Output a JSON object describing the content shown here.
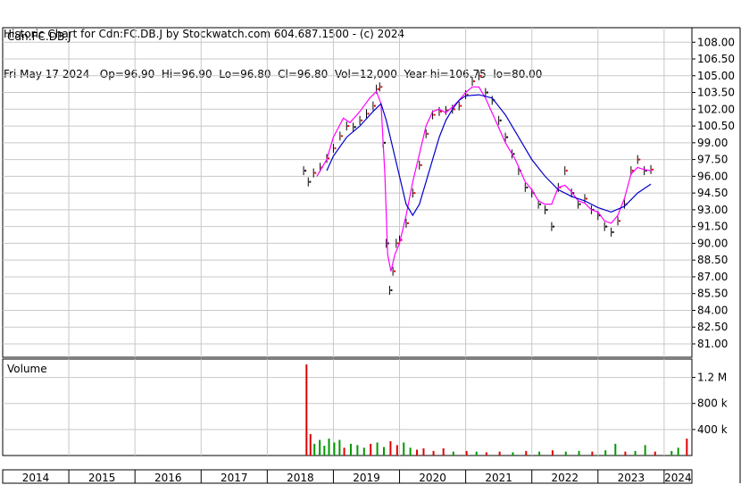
{
  "header": {
    "line1": "Historic Chart for Cdn:FC.DB.J by Stockwatch.com 604.687.1500 - (c) 2024",
    "line2": "Fri May 17 2024   Op=96.90  Hi=96.90  Lo=96.80  Cl=96.80  Vol=12,000  Year hi=106.75  lo=80.00"
  },
  "chart_data": {
    "type": "line",
    "title": "Cdn:FC.DB.J",
    "ylim": [
      79.8,
      109.3
    ],
    "y_ticks": [
      "108.00",
      "106.50",
      "105.00",
      "103.50",
      "102.00",
      "100.50",
      "99.00",
      "97.50",
      "96.00",
      "94.50",
      "93.00",
      "91.50",
      "90.00",
      "88.50",
      "87.00",
      "85.50",
      "84.00",
      "82.50",
      "81.00"
    ],
    "x_years": [
      "2014",
      "2015",
      "2016",
      "2017",
      "2018",
      "2019",
      "2020",
      "2021",
      "2022",
      "2023",
      "2024"
    ],
    "x_range": [
      2014.0,
      2024.42
    ],
    "price": [
      [
        2018.55,
        96.5
      ],
      [
        2018.62,
        95.5
      ],
      [
        2018.7,
        96.3
      ],
      [
        2018.8,
        96.8
      ],
      [
        2018.9,
        97.6
      ],
      [
        2019.0,
        98.5
      ],
      [
        2019.1,
        99.6
      ],
      [
        2019.2,
        100.5
      ],
      [
        2019.3,
        100.4
      ],
      [
        2019.4,
        101.0
      ],
      [
        2019.5,
        101.6
      ],
      [
        2019.6,
        102.3
      ],
      [
        2019.65,
        103.8
      ],
      [
        2019.7,
        104.0
      ],
      [
        2019.75,
        99.0
      ],
      [
        2019.8,
        90.0
      ],
      [
        2019.85,
        85.8
      ],
      [
        2019.9,
        87.5
      ],
      [
        2019.95,
        90.0
      ],
      [
        2020.0,
        90.3
      ],
      [
        2020.1,
        91.8
      ],
      [
        2020.2,
        94.5
      ],
      [
        2020.3,
        97.0
      ],
      [
        2020.4,
        99.8
      ],
      [
        2020.5,
        101.5
      ],
      [
        2020.6,
        101.8
      ],
      [
        2020.7,
        101.9
      ],
      [
        2020.8,
        102.0
      ],
      [
        2020.9,
        102.3
      ],
      [
        2021.0,
        103.3
      ],
      [
        2021.1,
        104.5
      ],
      [
        2021.2,
        105.0
      ],
      [
        2021.3,
        103.5
      ],
      [
        2021.4,
        102.8
      ],
      [
        2021.5,
        101.0
      ],
      [
        2021.6,
        99.5
      ],
      [
        2021.7,
        98.0
      ],
      [
        2021.8,
        96.5
      ],
      [
        2021.9,
        95.0
      ],
      [
        2022.0,
        94.5
      ],
      [
        2022.1,
        93.5
      ],
      [
        2022.2,
        93.0
      ],
      [
        2022.3,
        91.5
      ],
      [
        2022.4,
        95.0
      ],
      [
        2022.5,
        96.5
      ],
      [
        2022.6,
        94.5
      ],
      [
        2022.7,
        93.5
      ],
      [
        2022.8,
        94.0
      ],
      [
        2022.9,
        93.0
      ],
      [
        2023.0,
        92.5
      ],
      [
        2023.1,
        91.5
      ],
      [
        2023.2,
        91.0
      ],
      [
        2023.3,
        92.0
      ],
      [
        2023.4,
        93.5
      ],
      [
        2023.5,
        96.5
      ],
      [
        2023.6,
        97.5
      ],
      [
        2023.7,
        96.5
      ],
      [
        2023.8,
        96.6
      ]
    ],
    "series": [
      {
        "color": "#ff00ff",
        "values": [
          [
            2018.75,
            96.0
          ],
          [
            2018.9,
            97.5
          ],
          [
            2019.0,
            99.5
          ],
          [
            2019.15,
            101.2
          ],
          [
            2019.25,
            100.8
          ],
          [
            2019.4,
            101.8
          ],
          [
            2019.55,
            103.0
          ],
          [
            2019.65,
            103.6
          ],
          [
            2019.72,
            102.5
          ],
          [
            2019.78,
            96.0
          ],
          [
            2019.82,
            89.0
          ],
          [
            2019.87,
            87.5
          ],
          [
            2019.93,
            89.0
          ],
          [
            2020.0,
            90.0
          ],
          [
            2020.1,
            92.5
          ],
          [
            2020.2,
            95.5
          ],
          [
            2020.3,
            98.0
          ],
          [
            2020.4,
            100.5
          ],
          [
            2020.5,
            101.8
          ],
          [
            2020.6,
            102.0
          ],
          [
            2020.7,
            101.7
          ],
          [
            2020.8,
            102.2
          ],
          [
            2020.9,
            102.8
          ],
          [
            2021.0,
            103.5
          ],
          [
            2021.1,
            104.0
          ],
          [
            2021.2,
            104.0
          ],
          [
            2021.3,
            103.0
          ],
          [
            2021.45,
            101.0
          ],
          [
            2021.6,
            99.0
          ],
          [
            2021.75,
            97.5
          ],
          [
            2021.9,
            95.5
          ],
          [
            2022.0,
            94.8
          ],
          [
            2022.1,
            93.8
          ],
          [
            2022.2,
            93.5
          ],
          [
            2022.3,
            93.5
          ],
          [
            2022.4,
            95.0
          ],
          [
            2022.5,
            95.2
          ],
          [
            2022.6,
            94.6
          ],
          [
            2022.7,
            93.8
          ],
          [
            2022.8,
            93.6
          ],
          [
            2022.9,
            93.0
          ],
          [
            2023.0,
            92.8
          ],
          [
            2023.1,
            92.0
          ],
          [
            2023.2,
            91.8
          ],
          [
            2023.3,
            92.5
          ],
          [
            2023.4,
            94.0
          ],
          [
            2023.5,
            96.2
          ],
          [
            2023.6,
            96.8
          ],
          [
            2023.7,
            96.6
          ],
          [
            2023.8,
            96.5
          ]
        ]
      },
      {
        "color": "#0000cc",
        "values": [
          [
            2018.9,
            96.5
          ],
          [
            2019.0,
            97.8
          ],
          [
            2019.2,
            99.5
          ],
          [
            2019.4,
            100.5
          ],
          [
            2019.6,
            101.8
          ],
          [
            2019.72,
            102.5
          ],
          [
            2019.8,
            101.0
          ],
          [
            2019.9,
            98.5
          ],
          [
            2020.0,
            96.0
          ],
          [
            2020.1,
            93.5
          ],
          [
            2020.2,
            92.5
          ],
          [
            2020.3,
            93.5
          ],
          [
            2020.4,
            95.5
          ],
          [
            2020.5,
            97.5
          ],
          [
            2020.6,
            99.5
          ],
          [
            2020.7,
            101.0
          ],
          [
            2020.8,
            102.0
          ],
          [
            2020.9,
            102.8
          ],
          [
            2021.0,
            103.2
          ],
          [
            2021.2,
            103.3
          ],
          [
            2021.4,
            103.0
          ],
          [
            2021.6,
            101.5
          ],
          [
            2021.8,
            99.5
          ],
          [
            2022.0,
            97.5
          ],
          [
            2022.2,
            96.0
          ],
          [
            2022.4,
            94.8
          ],
          [
            2022.6,
            94.2
          ],
          [
            2022.8,
            93.8
          ],
          [
            2023.0,
            93.2
          ],
          [
            2023.2,
            92.8
          ],
          [
            2023.4,
            93.3
          ],
          [
            2023.6,
            94.5
          ],
          [
            2023.8,
            95.3
          ]
        ]
      }
    ],
    "volume": {
      "label": "Volume",
      "y_ticks": [
        "1.2 M",
        "800 k",
        "400 k"
      ],
      "ylim": [
        0,
        1400000
      ],
      "bars": [
        [
          2018.58,
          1400000,
          "#e00000"
        ],
        [
          2018.64,
          330000,
          "#e00000"
        ],
        [
          2018.7,
          180000,
          "#009900"
        ],
        [
          2018.78,
          240000,
          "#009900"
        ],
        [
          2018.85,
          150000,
          "#009900"
        ],
        [
          2018.92,
          260000,
          "#009900"
        ],
        [
          2019.0,
          200000,
          "#009900"
        ],
        [
          2019.08,
          240000,
          "#009900"
        ],
        [
          2019.15,
          120000,
          "#e00000"
        ],
        [
          2019.25,
          180000,
          "#009900"
        ],
        [
          2019.35,
          160000,
          "#009900"
        ],
        [
          2019.45,
          120000,
          "#009900"
        ],
        [
          2019.55,
          180000,
          "#e00000"
        ],
        [
          2019.65,
          200000,
          "#009900"
        ],
        [
          2019.75,
          130000,
          "#009900"
        ],
        [
          2019.85,
          220000,
          "#e00000"
        ],
        [
          2019.95,
          160000,
          "#e00000"
        ],
        [
          2020.05,
          200000,
          "#009900"
        ],
        [
          2020.15,
          120000,
          "#009900"
        ],
        [
          2020.25,
          90000,
          "#e00000"
        ],
        [
          2020.35,
          110000,
          "#e00000"
        ],
        [
          2020.5,
          70000,
          "#e00000"
        ],
        [
          2020.65,
          110000,
          "#e00000"
        ],
        [
          2020.8,
          60000,
          "#009900"
        ],
        [
          2021.0,
          70000,
          "#e00000"
        ],
        [
          2021.15,
          60000,
          "#009900"
        ],
        [
          2021.3,
          50000,
          "#e00000"
        ],
        [
          2021.5,
          60000,
          "#e00000"
        ],
        [
          2021.7,
          50000,
          "#009900"
        ],
        [
          2021.9,
          70000,
          "#e00000"
        ],
        [
          2022.1,
          60000,
          "#009900"
        ],
        [
          2022.3,
          80000,
          "#e00000"
        ],
        [
          2022.5,
          60000,
          "#009900"
        ],
        [
          2022.7,
          70000,
          "#009900"
        ],
        [
          2022.9,
          60000,
          "#e00000"
        ],
        [
          2023.1,
          80000,
          "#009900"
        ],
        [
          2023.25,
          180000,
          "#009900"
        ],
        [
          2023.4,
          60000,
          "#e00000"
        ],
        [
          2023.55,
          70000,
          "#009900"
        ],
        [
          2023.7,
          160000,
          "#009900"
        ],
        [
          2023.85,
          60000,
          "#e00000"
        ],
        [
          2024.1,
          70000,
          "#009900"
        ],
        [
          2024.2,
          120000,
          "#009900"
        ],
        [
          2024.33,
          260000,
          "#e00000"
        ]
      ]
    },
    "colors": {
      "price_up": "#e00000",
      "price_bar": "#000000",
      "grid": "#c8c8c8"
    }
  }
}
